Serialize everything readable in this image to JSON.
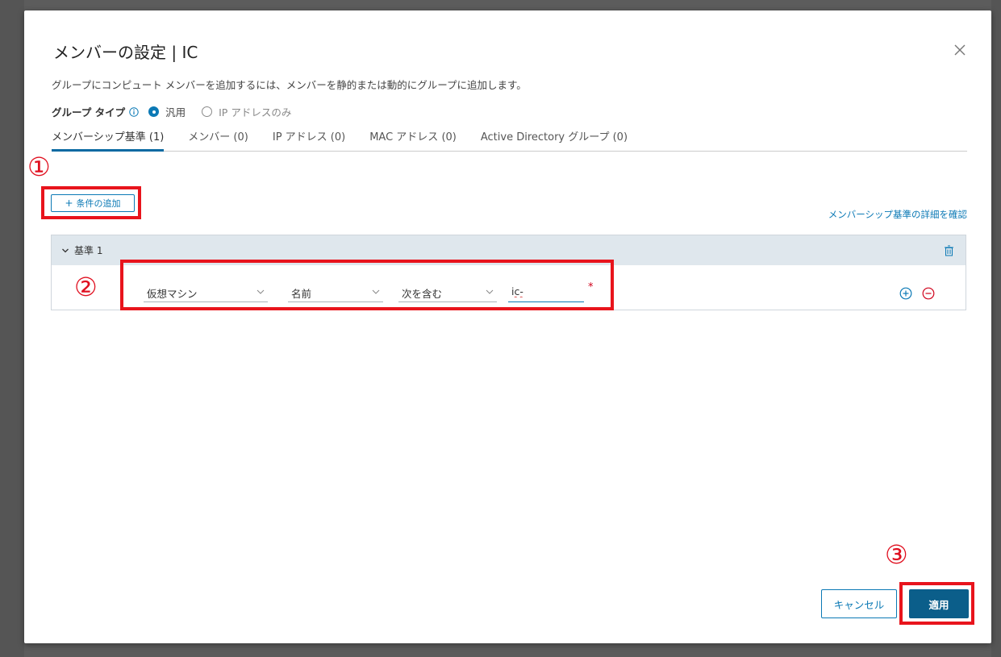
{
  "dialog": {
    "title": "メンバーの設定 | IC",
    "description": "グループにコンピュート メンバーを追加するには、メンバーを静的または動的にグループに追加します。"
  },
  "group_type": {
    "label": "グループ タイプ",
    "options": [
      {
        "label": "汎用",
        "selected": true
      },
      {
        "label": "IP アドレスのみ",
        "selected": false
      }
    ]
  },
  "tabs": [
    {
      "label": "メンバーシップ基準 (1)",
      "active": true
    },
    {
      "label": "メンバー (0)",
      "active": false
    },
    {
      "label": "IP アドレス (0)",
      "active": false
    },
    {
      "label": "MAC アドレス (0)",
      "active": false
    },
    {
      "label": "Active Directory グループ (0)",
      "active": false
    }
  ],
  "toolbar": {
    "add_condition_label": "条件の追加",
    "details_link": "メンバーシップ基準の詳細を確認"
  },
  "criteria": {
    "header": "基準 1",
    "row": {
      "member_type": "仮想マシン",
      "attribute": "名前",
      "operator": "次を含む",
      "value": "ic-",
      "required_mark": "*"
    }
  },
  "annotations": {
    "step1": "①",
    "step2": "②",
    "step3": "③"
  },
  "footer": {
    "cancel_label": "キャンセル",
    "apply_label": "適用"
  },
  "colors": {
    "accent": "#0b79b5",
    "primary_button": "#0b5e8a",
    "annotation_red": "#e8141c",
    "criteria_header_bg": "#dfe7ed"
  }
}
